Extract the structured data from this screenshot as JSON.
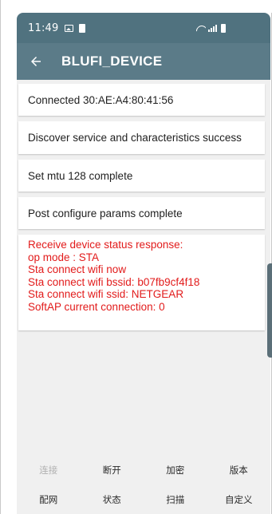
{
  "status_bar": {
    "time": "11:49",
    "icons_left": [
      "image-icon",
      "sim-icon"
    ],
    "icons_right": [
      "wifi-icon",
      "signal-icon",
      "battery-icon"
    ]
  },
  "app_bar": {
    "title": "BLUFI_DEVICE",
    "back_icon": "back-arrow-icon"
  },
  "log": {
    "messages": [
      "Connected 30:AE:A4:80:41:56",
      "Discover service and characteristics success",
      "Set mtu 128 complete",
      "Post configure params complete"
    ],
    "status_response": [
      "Receive device status response:",
      "op mode : STA",
      "Sta connect wifi now",
      "Sta connect wifi bssid: b07fb9cf4f18",
      "Sta connect wifi ssid: NETGEAR",
      "SoftAP current connection: 0"
    ],
    "status_color": "#e21b1b"
  },
  "buttons": {
    "row1": [
      "连接",
      "断开",
      "加密",
      "版本"
    ],
    "row2": [
      "配网",
      "状态",
      "扫描",
      "自定义"
    ],
    "connect_enabled": false
  },
  "colors": {
    "status_bar": "#50727f",
    "app_bar": "#5b7b88",
    "background": "#f0f0f0"
  }
}
